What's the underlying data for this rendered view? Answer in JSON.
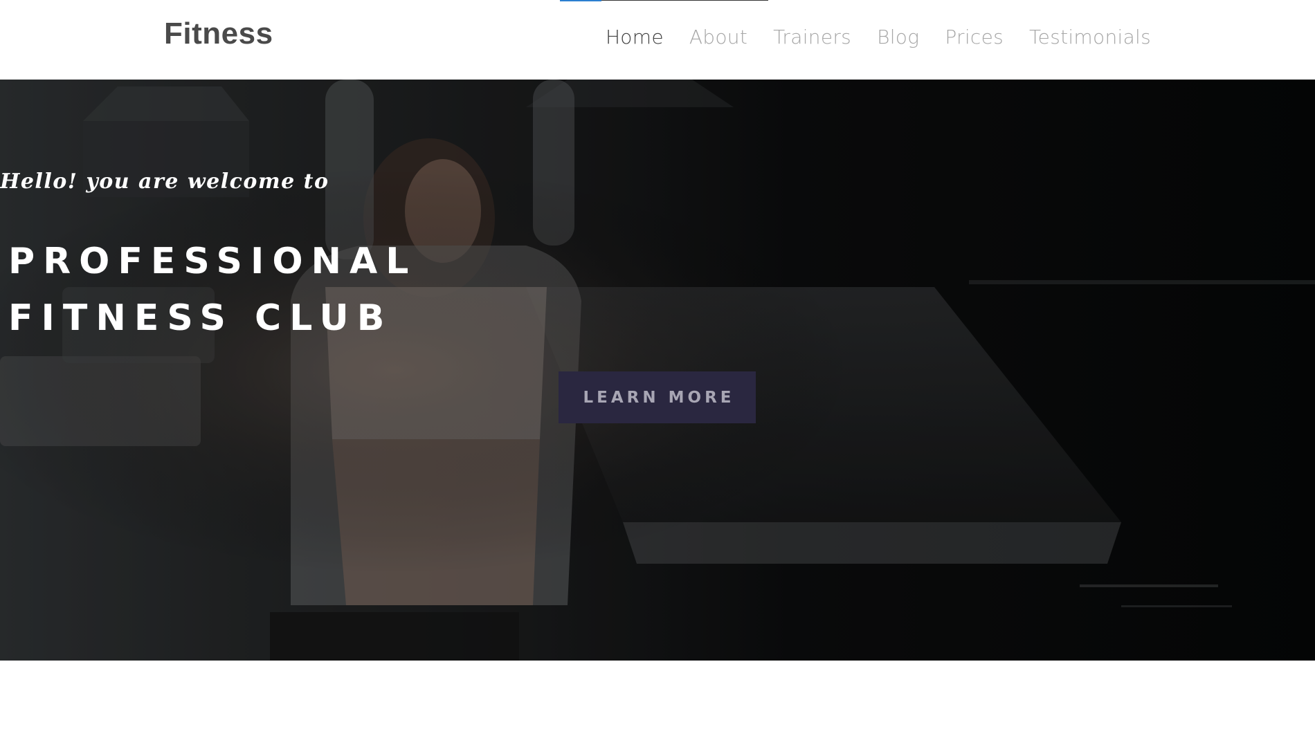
{
  "header": {
    "logo": "Fitness",
    "nav": [
      {
        "label": "Home",
        "active": true
      },
      {
        "label": "About",
        "active": false
      },
      {
        "label": "Trainers",
        "active": false
      },
      {
        "label": "Blog",
        "active": false
      },
      {
        "label": "Prices",
        "active": false
      },
      {
        "label": "Testimonials",
        "active": false
      }
    ]
  },
  "hero": {
    "greeting": "Hello! you are welcome to",
    "title_line1": "PROFESSIONAL",
    "title_line2": "FITNESS CLUB",
    "cta_label": "LEARN MORE"
  },
  "colors": {
    "nav_active": "#3f3f3f",
    "nav_inactive": "#a6a6a6",
    "cta_background": "#2a2740",
    "cta_text": "#a8a6b4",
    "hero_text": "#ffffff"
  }
}
